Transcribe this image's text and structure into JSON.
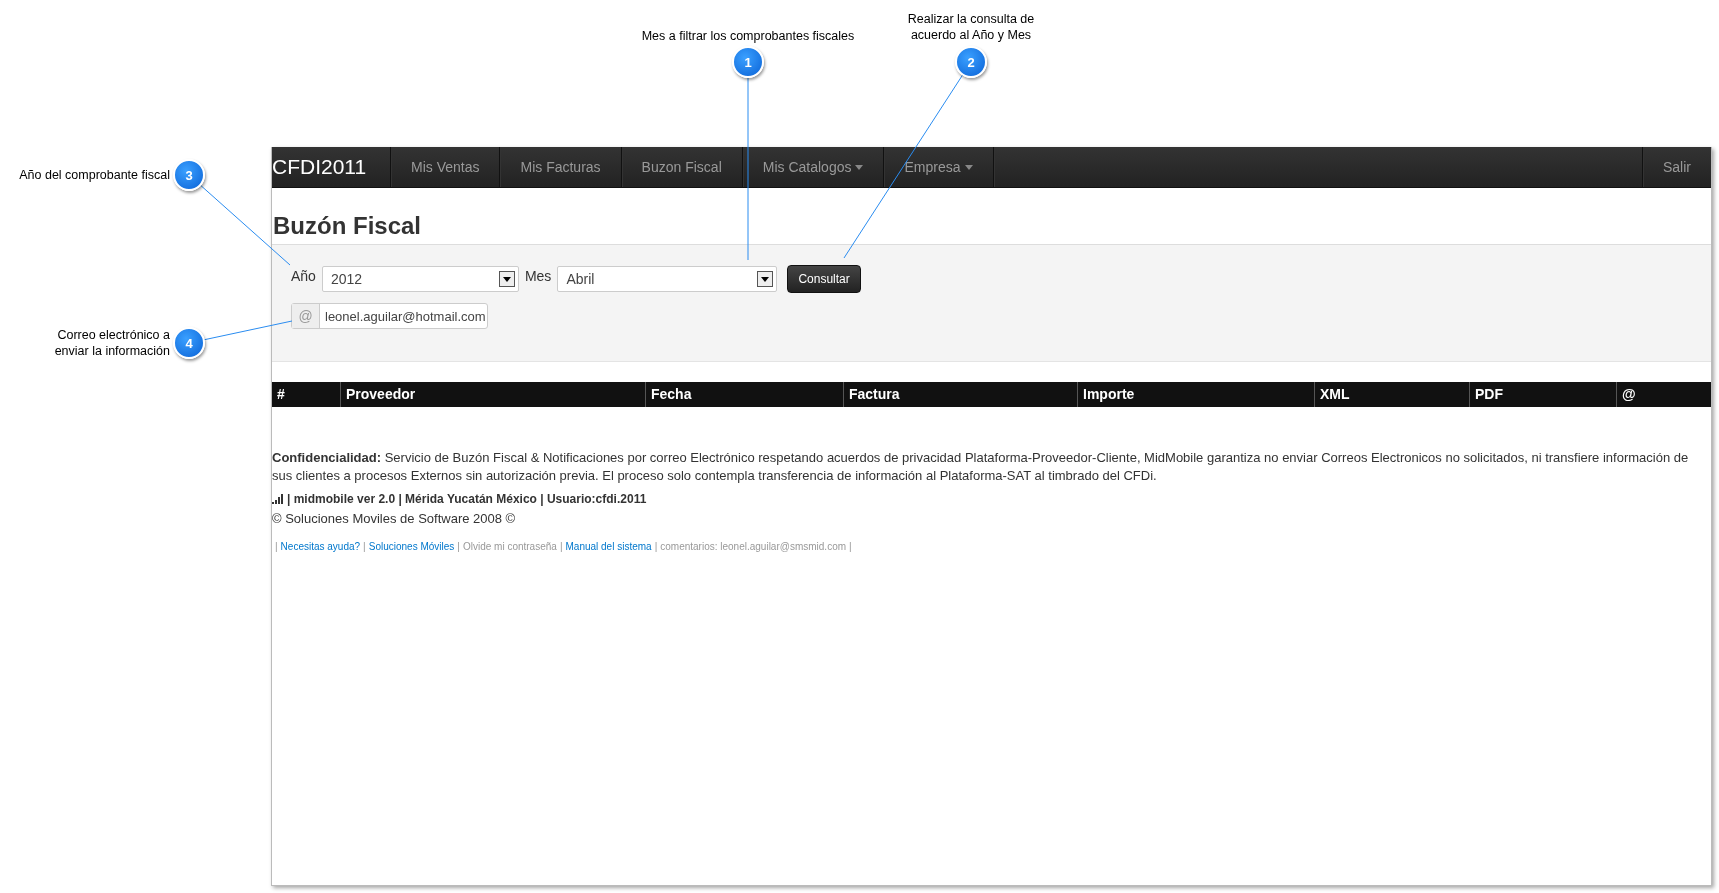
{
  "callouts": [
    {
      "number": "1",
      "label": "Mes a filtrar los comprobantes fiscales"
    },
    {
      "number": "2",
      "label": "Realizar la consulta de\nacuerdo al Año y Mes"
    },
    {
      "number": "3",
      "label": "Año del comprobante fiscal"
    },
    {
      "number": "4",
      "label": "Correo electrónico a\nenviar la información"
    }
  ],
  "navbar": {
    "brand": "CFDI2011",
    "items": [
      {
        "label": "Mis Ventas",
        "dropdown": false
      },
      {
        "label": "Mis Facturas",
        "dropdown": false
      },
      {
        "label": "Buzon Fiscal",
        "dropdown": false
      },
      {
        "label": "Mis Catalogos",
        "dropdown": true
      },
      {
        "label": "Empresa",
        "dropdown": true
      }
    ],
    "logout": "Salir"
  },
  "page_title": "Buzón Fiscal",
  "form": {
    "year_label": "Año",
    "year_value": "2012",
    "month_label": "Mes",
    "month_value": "Abril",
    "submit": "Consultar",
    "email_prefix": "@",
    "email_value": "leonel.aguilar@hotmail.com"
  },
  "table": {
    "columns": [
      "#",
      "Proveedor",
      "Fecha",
      "Factura",
      "Importe",
      "XML",
      "PDF",
      "@"
    ]
  },
  "footer": {
    "notice": "**Confidencialidad:** Servicio de Buzón Fiscal & Notificaciones por correo Electrónico respetando acuerdos de privacidad Plataforma-Proveedor-Cliente, MidMobile garantiza no enviar Correos Electronicos no solicitados, ni transfiere información de sus clientes a procesos Externos sin autorización previa. El proceso solo contempla transferencia de información al Plataforma-SAT al timbrado del CFDi.",
    "version": "| midmobile ver 2.0 | Mérida Yucatán México | Usuario:cfdi.2011",
    "copyright": "© Soluciones Moviles de Software 2008 ©",
    "separator": "|",
    "links": [
      {
        "kind": "link",
        "text": "Necesitas ayuda?"
      },
      {
        "kind": "link",
        "text": "Soluciones Móviles"
      },
      {
        "kind": "text",
        "text": "Olvide mi contraseña"
      },
      {
        "kind": "link",
        "text": "Manual del sistema"
      },
      {
        "kind": "text",
        "text": "comentarios: leonel.aguilar@smsmid.com"
      }
    ]
  }
}
